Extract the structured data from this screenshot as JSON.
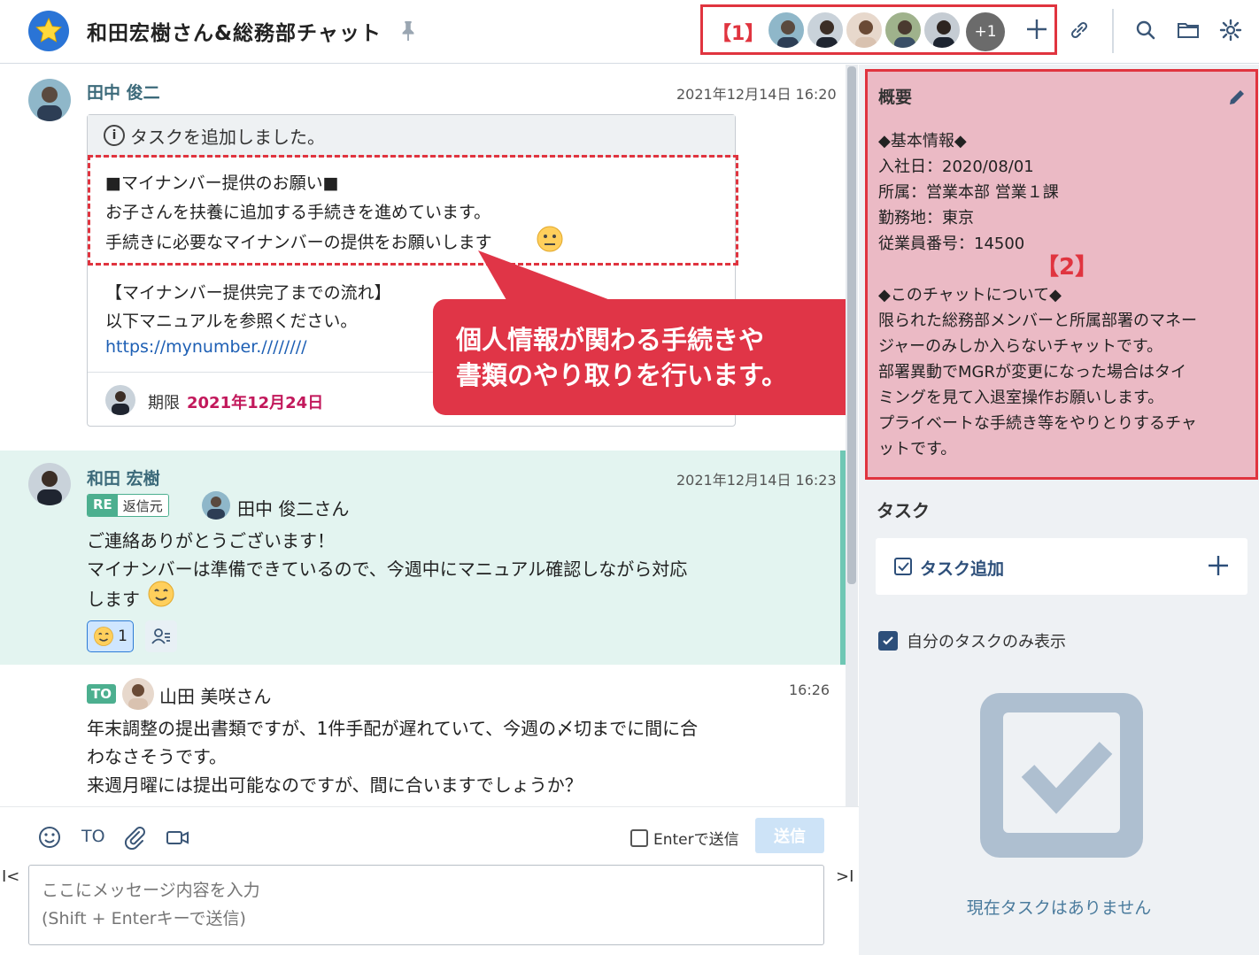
{
  "header": {
    "title": "和田宏樹さん&総務部チャット",
    "members_marker": "【1】",
    "more_members": "+1"
  },
  "messages": [
    {
      "sender": "田中 俊二",
      "time": "2021年12月14日 16:20",
      "task_notice": "タスクを追加しました。",
      "lines": [
        "■マイナンバー提供のお願い■",
        "お子さんを扶養に追加する手続きを進めています。",
        "手続きに必要なマイナンバーの提供をお願いします"
      ],
      "lines2": [
        "【マイナンバー提供完了までの流れ】",
        "以下マニュアルを参照ください。"
      ],
      "link": "https://mynumber.////////",
      "due_label": "期限",
      "due_value": "2021年12月24日"
    },
    {
      "sender": "和田 宏樹",
      "time": "2021年12月14日 16:23",
      "re_label": "RE",
      "re_source": "返信元",
      "reply_to": "田中 俊二さん",
      "lines": [
        "ご連絡ありがとうございます！",
        "マイナンバーは準備できているので、今週中にマニュアル確認しながら対応",
        "します"
      ],
      "reaction_count": "1"
    },
    {
      "time": "16:26",
      "to_label": "TO",
      "to_name": "山田 美咲さん",
      "lines": [
        "年末調整の提出書類ですが、1件手配が遅れていて、今週の〆切までに間に合",
        "わなさそうです。",
        "来週月曜には提出可能なのですが、間に合いますでしょうか？"
      ]
    }
  ],
  "callout": {
    "line1": "個人情報が関わる手続きや",
    "line2": "書類のやり取りを行います。"
  },
  "composer": {
    "to_label": "TO",
    "enter_send": "Enterで送信",
    "send_label": "送信",
    "placeholder": "ここにメッセージ内容を入力\n(Shift + Enterキーで送信)"
  },
  "sidebar": {
    "summary_title": "概要",
    "marker": "【2】",
    "summary_lines": [
      "◆基本情報◆",
      "入社日：2020/08/01",
      "所属：営業本部 営業１課",
      "勤務地：東京",
      "従業員番号：14500",
      "",
      "◆このチャットについて◆",
      "限られた総務部メンバーと所属部署のマネー",
      "ジャーのみしか入らないチャットです。",
      "部署異動でMGRが変更になった場合はタイ",
      "ミングを見て入退室操作お願いします。",
      "プライベートな手続き等をやりとりするチャ",
      "ットです。"
    ],
    "task_title": "タスク",
    "task_add": "タスク追加",
    "own_only": "自分のタスクのみ表示",
    "empty": "現在タスクはありません"
  },
  "colors": {
    "accent_red": "#e0343f",
    "reply_green": "#4caf8f",
    "due_pink": "#c2185b"
  }
}
